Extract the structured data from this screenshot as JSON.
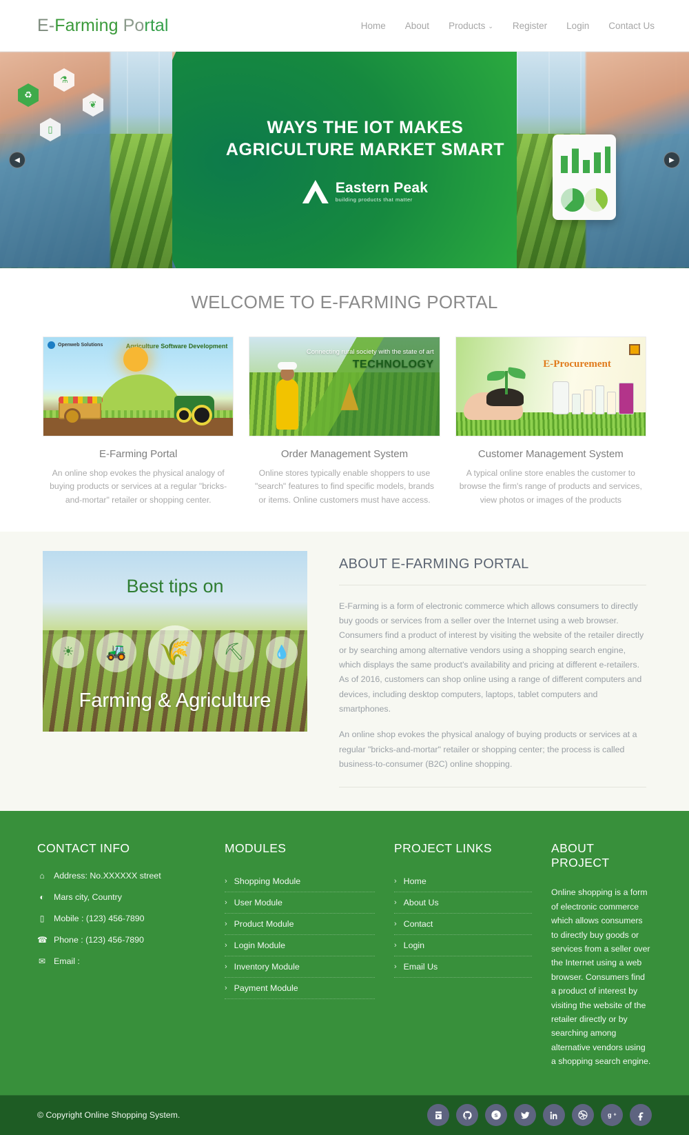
{
  "header": {
    "logo_parts": [
      "E-",
      "Farming",
      " Po",
      "rtal"
    ],
    "logo_text": "E-Farming Portal",
    "nav": [
      {
        "label": "Home",
        "has_dropdown": false
      },
      {
        "label": "About",
        "has_dropdown": false
      },
      {
        "label": "Products",
        "has_dropdown": true,
        "caret": "⌄"
      },
      {
        "label": "Register",
        "has_dropdown": false
      },
      {
        "label": "Login",
        "has_dropdown": false
      },
      {
        "label": "Contact Us",
        "has_dropdown": false
      }
    ]
  },
  "hero": {
    "title": "WAYS THE IOT MAKES AGRICULTURE MARKET SMART",
    "brand_name": "Eastern Peak",
    "brand_tagline": "building products that matter",
    "prev_icon": "◀",
    "next_icon": "▶"
  },
  "welcome": {
    "heading": "WELCOME TO E-FARMING PORTAL",
    "cards": [
      {
        "title": "E-Farming Portal",
        "text": "An online shop evokes the physical analogy of buying products or services at a regular \"bricks-and-mortar\" retailer or shopping center.",
        "image_brand": "Openweb Solutions",
        "image_caption": "Agriculture Software Development"
      },
      {
        "title": "Order Management System",
        "text": "Online stores typically enable shoppers to use \"search\" features to find specific models, brands or items. Online customers must have access.",
        "image_caption_small": "Connecting  rural society with the state of art",
        "image_caption_big": "TECHNOLOGY"
      },
      {
        "title": "Customer Management System",
        "text": "A typical online store enables the customer to browse the firm's range of products and services, view photos or images of the products",
        "image_caption": "E-Procurement"
      }
    ]
  },
  "about": {
    "image_top_text": "Best tips on",
    "image_bottom_text": "Farming & Agriculture",
    "image_icons": [
      "sun-icon",
      "tractor-icon",
      "wheat-icon",
      "farmer-icon",
      "water-drop-icon"
    ],
    "title": "ABOUT E-FARMING PORTAL",
    "paragraphs": [
      "E-Farming is a form of electronic commerce which allows consumers to directly buy goods or services from a seller over the Internet using a web browser. Consumers find a product of interest by visiting the website of the retailer directly or by searching among alternative vendors using a shopping search engine, which displays the same product's availability and pricing at different e-retailers. As of 2016, customers can shop online using a range of different computers and devices, including desktop computers, laptops, tablet computers and smartphones.",
      "An online shop evokes the physical analogy of buying products or services at a regular \"bricks-and-mortar\" retailer or shopping center; the process is called business-to-consumer (B2C) online shopping."
    ]
  },
  "footer": {
    "contact": {
      "title": "CONTACT INFO",
      "lines": [
        {
          "icon": "home-icon",
          "glyph": "⌂",
          "text": "Address: No.XXXXXX street"
        },
        {
          "icon": "globe-icon",
          "glyph": "◐",
          "text": "Mars city, Country"
        },
        {
          "icon": "mobile-icon",
          "glyph": "▯",
          "text": "Mobile : (123) 456-7890"
        },
        {
          "icon": "phone-icon",
          "glyph": "☎",
          "text": "Phone : (123) 456-7890"
        },
        {
          "icon": "envelope-icon",
          "glyph": "✉",
          "text": "Email :"
        }
      ]
    },
    "modules": {
      "title": "MODULES",
      "items": [
        "Shopping Module",
        "User Module",
        "Product Module",
        "Login Module",
        "Inventory Module",
        "Payment Module"
      ]
    },
    "project_links": {
      "title": "PROJECT LINKS",
      "items": [
        "Home",
        "About Us",
        "Contact",
        "Login",
        "Email Us"
      ]
    },
    "about_project": {
      "title": "ABOUT PROJECT",
      "text": "Online shopping is a form of electronic commerce which allows consumers to directly buy goods or services from a seller over the Internet using a web browser. Consumers find a product of interest by visiting the website of the retailer directly or by searching among alternative vendors using a shopping search engine."
    },
    "chevron": "›"
  },
  "bottom": {
    "copyright": "© Copyright Online Shopping System.",
    "socials": [
      {
        "name": "youtube-icon",
        "glyph": "▶"
      },
      {
        "name": "github-icon",
        "glyph": "●"
      },
      {
        "name": "skype-icon",
        "glyph": "S"
      },
      {
        "name": "twitter-icon",
        "glyph": "ᴛ"
      },
      {
        "name": "linkedin-icon",
        "glyph": "in"
      },
      {
        "name": "dribbble-icon",
        "glyph": "◎"
      },
      {
        "name": "googleplus-icon",
        "glyph": "g+"
      },
      {
        "name": "facebook-icon",
        "glyph": "f"
      }
    ]
  },
  "colors": {
    "brand_green": "#38903b",
    "footer_dark": "#1e5c24",
    "hero_green": "#16893f",
    "logo_green": "#35a04a",
    "social_bg": "#5e6480",
    "about_bg": "#f7f8f2"
  }
}
